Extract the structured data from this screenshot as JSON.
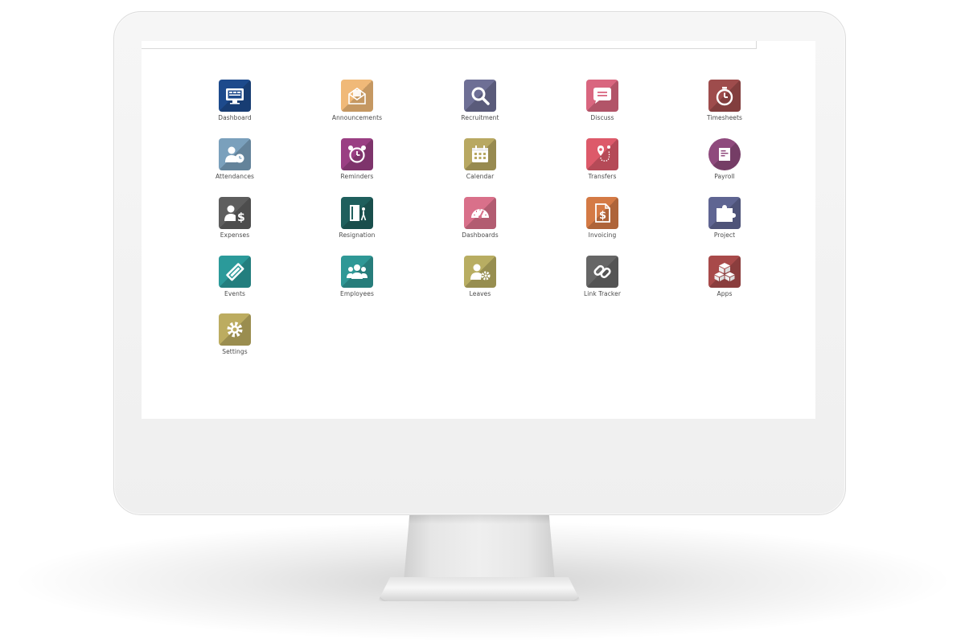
{
  "apps": [
    {
      "label": "Dashboard",
      "icon": "monitor-icon",
      "color": "#1d4a8c"
    },
    {
      "label": "Announcements",
      "icon": "envelope-icon",
      "color": "#f0b978"
    },
    {
      "label": "Recruitment",
      "icon": "search-icon",
      "color": "#6e6f95"
    },
    {
      "label": "Discuss",
      "icon": "chat-icon",
      "color": "#d9667f"
    },
    {
      "label": "Timesheets",
      "icon": "stopwatch-icon",
      "color": "#9e4c4c"
    },
    {
      "label": "Attendances",
      "icon": "user-clock-icon",
      "color": "#7aa0bc"
    },
    {
      "label": "Reminders",
      "icon": "alarm-clock-icon",
      "color": "#9a3f83"
    },
    {
      "label": "Calendar",
      "icon": "calendar-icon",
      "color": "#b8a862"
    },
    {
      "label": "Transfers",
      "icon": "map-route-icon",
      "color": "#dd5a6a"
    },
    {
      "label": "Payroll",
      "icon": "payroll-icon",
      "color": "#8f4a7d"
    },
    {
      "label": "Expenses",
      "icon": "user-dollar-icon",
      "color": "#5e5e5e"
    },
    {
      "label": "Resignation",
      "icon": "exit-door-icon",
      "color": "#1f5f5d"
    },
    {
      "label": "Dashboards",
      "icon": "gauge-icon",
      "color": "#d9708a"
    },
    {
      "label": "Invoicing",
      "icon": "invoice-icon",
      "color": "#d47a45"
    },
    {
      "label": "Project",
      "icon": "puzzle-icon",
      "color": "#5f6592"
    },
    {
      "label": "Events",
      "icon": "ticket-icon",
      "color": "#2b9a9a"
    },
    {
      "label": "Employees",
      "icon": "users-icon",
      "color": "#2f9896"
    },
    {
      "label": "Leaves",
      "icon": "user-gear-icon",
      "color": "#b8ad62"
    },
    {
      "label": "Link Tracker",
      "icon": "link-icon",
      "color": "#666666"
    },
    {
      "label": "Apps",
      "icon": "cubes-icon",
      "color": "#a84a4a"
    },
    {
      "label": "Settings",
      "icon": "gear-icon",
      "color": "#bcac60"
    }
  ]
}
